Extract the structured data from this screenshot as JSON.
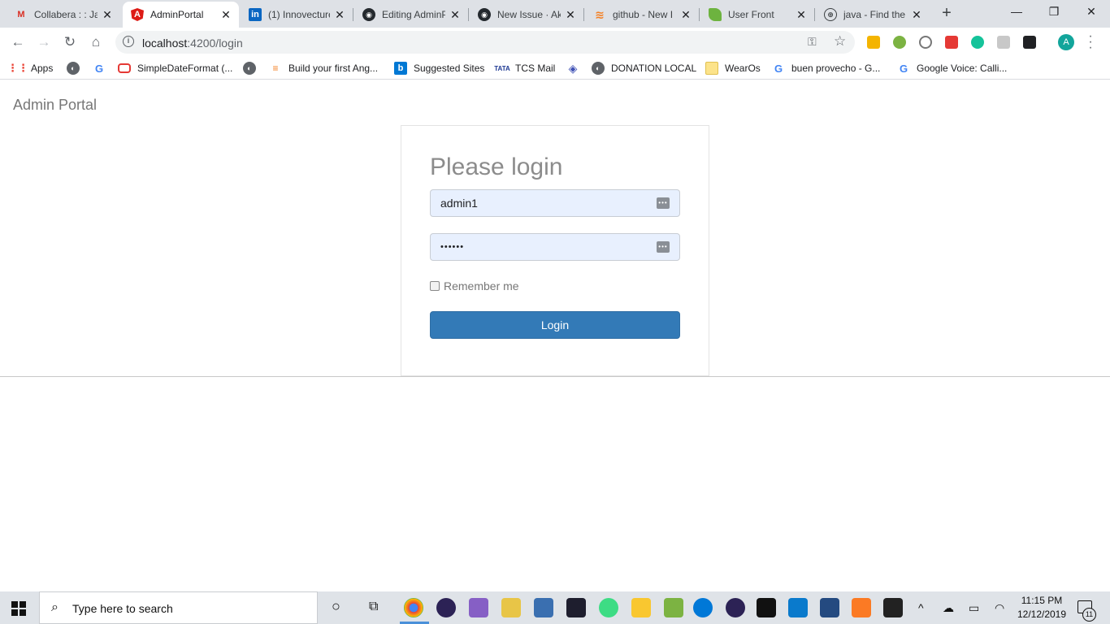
{
  "browser": {
    "tabs": [
      {
        "title": "Collabera : : Ja",
        "favicon": "gmail-icon",
        "active": false
      },
      {
        "title": "AdminPortal",
        "favicon": "angular-icon",
        "active": true
      },
      {
        "title": "(1) Innovecture",
        "favicon": "linkedin-icon",
        "active": false
      },
      {
        "title": "Editing AdminP",
        "favicon": "github-icon",
        "active": false
      },
      {
        "title": "New Issue · Ak",
        "favicon": "github-icon",
        "active": false
      },
      {
        "title": "github - New I",
        "favicon": "stackoverflow-icon",
        "active": false
      },
      {
        "title": "User Front",
        "favicon": "spring-leaf-icon",
        "active": false
      },
      {
        "title": "java - Find the",
        "favicon": "globe-icon",
        "active": false
      }
    ],
    "new_tab": "+",
    "window_controls": {
      "minimize": "—",
      "restore": "❐",
      "close": "✕"
    },
    "address": {
      "host": "localhost",
      "path": ":4200/login"
    },
    "bookmarks": [
      {
        "label": "Apps",
        "icon": "apps-grid-icon"
      },
      {
        "label": "",
        "icon": "globe-icon"
      },
      {
        "label": "",
        "icon": "google-icon"
      },
      {
        "label": "SimpleDateFormat (...",
        "icon": "oracle-icon"
      },
      {
        "label": "",
        "icon": "globe-icon"
      },
      {
        "label": "Build your first Ang...",
        "icon": "bars-icon"
      },
      {
        "label": "Suggested Sites",
        "icon": "bing-icon"
      },
      {
        "label": "TCS Mail",
        "icon": "tata-icon"
      },
      {
        "label": "",
        "icon": "diamond-icon"
      },
      {
        "label": "DONATION LOCAL",
        "icon": "globe-icon"
      },
      {
        "label": "WearOs",
        "icon": "folder-icon"
      },
      {
        "label": "buen provecho - G...",
        "icon": "google-icon"
      },
      {
        "label": "Google Voice: Calli...",
        "icon": "google-icon"
      }
    ],
    "profile_initial": "A"
  },
  "page": {
    "brand": "Admin Portal",
    "login": {
      "heading": "Please login",
      "username_value": "admin1",
      "password_mask": "••••••",
      "remember_label": "Remember me",
      "remember_checked": false,
      "submit_label": "Login"
    }
  },
  "taskbar": {
    "search_placeholder": "Type here to search",
    "time": "11:15 PM",
    "date": "12/12/2019",
    "notifications": "11"
  },
  "colors": {
    "primary_button": "#337ab7",
    "autofill_bg": "#e8f0fe",
    "brand_text": "#777777"
  }
}
